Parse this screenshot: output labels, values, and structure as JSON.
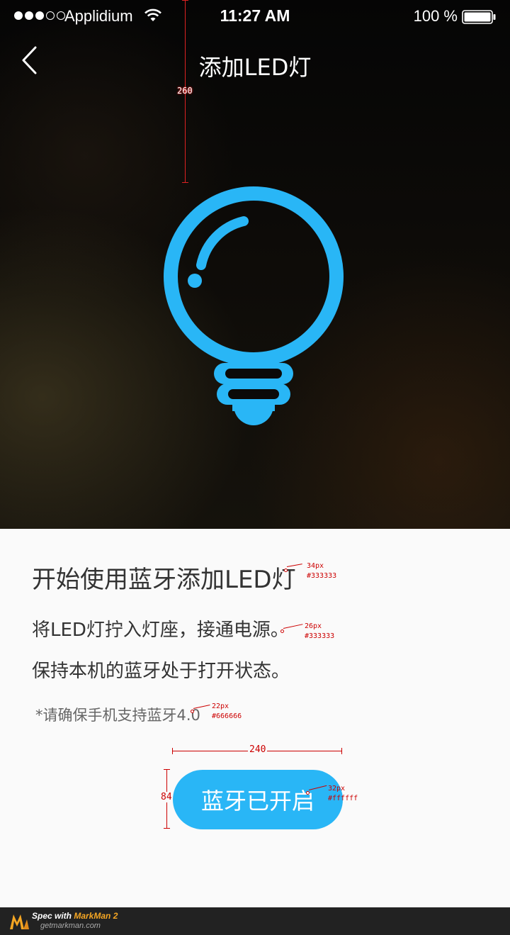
{
  "status_bar": {
    "carrier": "Applidium",
    "time": "11:27 AM",
    "battery": "100 %"
  },
  "nav": {
    "title": "添加LED灯"
  },
  "spec": {
    "top_offset_label": "260",
    "heading_font": "34px",
    "heading_color": "#333333",
    "body_font": "26px",
    "body_color": "#333333",
    "note_font": "22px",
    "note_color": "#666666",
    "button_width": "240",
    "button_height": "84",
    "button_font": "32px",
    "button_color": "#ffffff"
  },
  "content": {
    "heading": "开始使用蓝牙添加LED灯",
    "line1": "将LED灯拧入灯座，接通电源。",
    "line2": "保持本机的蓝牙处于打开状态。",
    "note": "*请确保手机支持蓝牙4.0"
  },
  "button": {
    "label": "蓝牙已开启"
  },
  "footer": {
    "prefix": "Spec with ",
    "brand": "MarkMan 2",
    "url": "getmarkman.com"
  },
  "colors": {
    "accent": "#29b6f6",
    "background": "#fafafa"
  },
  "icons": {
    "back": "chevron-left-icon",
    "bulb": "light-bulb-icon",
    "wifi": "wifi-icon",
    "battery": "battery-icon"
  }
}
